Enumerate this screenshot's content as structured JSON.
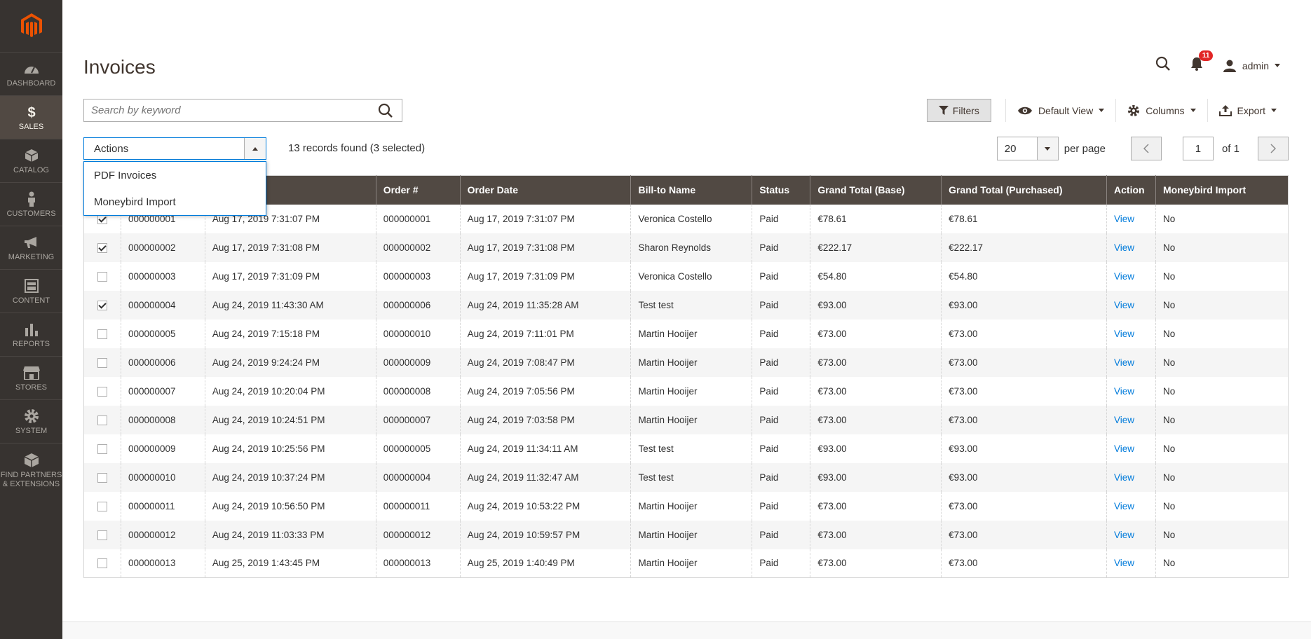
{
  "sidebar": {
    "items": [
      {
        "label": "DASHBOARD",
        "icon": "dashboard-icon"
      },
      {
        "label": "SALES",
        "icon": "dollar-icon",
        "active": true
      },
      {
        "label": "CATALOG",
        "icon": "cube-icon"
      },
      {
        "label": "CUSTOMERS",
        "icon": "person-icon"
      },
      {
        "label": "MARKETING",
        "icon": "megaphone-icon"
      },
      {
        "label": "CONTENT",
        "icon": "content-icon"
      },
      {
        "label": "REPORTS",
        "icon": "bar-chart-icon"
      },
      {
        "label": "STORES",
        "icon": "store-icon"
      },
      {
        "label": "SYSTEM",
        "icon": "gear-icon"
      }
    ],
    "partners": {
      "line1": "FIND PARTNERS",
      "line2": "& EXTENSIONS"
    }
  },
  "header": {
    "title": "Invoices",
    "notifications_count": "11",
    "user": "admin"
  },
  "search": {
    "placeholder": "Search by keyword"
  },
  "toolbar": {
    "filters": "Filters",
    "view": "Default View",
    "columns": "Columns",
    "export": "Export"
  },
  "actions": {
    "label": "Actions",
    "options": [
      "PDF Invoices",
      "Moneybird Import"
    ]
  },
  "records": "13 records found (3 selected)",
  "pager": {
    "per_page": "20",
    "per_page_label": "per page",
    "page": "1",
    "of": "of 1"
  },
  "grid": {
    "columns": [
      "",
      "",
      "",
      "Order #",
      "Order Date",
      "Bill-to Name",
      "Status",
      "Grand Total (Base)",
      "Grand Total (Purchased)",
      "Action",
      "Moneybird Import"
    ],
    "rows": [
      {
        "checked": true,
        "invoice": "000000001",
        "invoice_date": "Aug 17, 2019 7:31:07 PM",
        "order": "000000001",
        "order_date": "Aug 17, 2019 7:31:07 PM",
        "name": "Veronica Costello",
        "status": "Paid",
        "base": "€78.61",
        "purchased": "€78.61",
        "action": "View",
        "moneybird": "No"
      },
      {
        "checked": true,
        "invoice": "000000002",
        "invoice_date": "Aug 17, 2019 7:31:08 PM",
        "order": "000000002",
        "order_date": "Aug 17, 2019 7:31:08 PM",
        "name": "Sharon Reynolds",
        "status": "Paid",
        "base": "€222.17",
        "purchased": "€222.17",
        "action": "View",
        "moneybird": "No"
      },
      {
        "checked": false,
        "invoice": "000000003",
        "invoice_date": "Aug 17, 2019 7:31:09 PM",
        "order": "000000003",
        "order_date": "Aug 17, 2019 7:31:09 PM",
        "name": "Veronica Costello",
        "status": "Paid",
        "base": "€54.80",
        "purchased": "€54.80",
        "action": "View",
        "moneybird": "No"
      },
      {
        "checked": true,
        "invoice": "000000004",
        "invoice_date": "Aug 24, 2019 11:43:30 AM",
        "order": "000000006",
        "order_date": "Aug 24, 2019 11:35:28 AM",
        "name": "Test test",
        "status": "Paid",
        "base": "€93.00",
        "purchased": "€93.00",
        "action": "View",
        "moneybird": "No"
      },
      {
        "checked": false,
        "invoice": "000000005",
        "invoice_date": "Aug 24, 2019 7:15:18 PM",
        "order": "000000010",
        "order_date": "Aug 24, 2019 7:11:01 PM",
        "name": "Martin Hooijer",
        "status": "Paid",
        "base": "€73.00",
        "purchased": "€73.00",
        "action": "View",
        "moneybird": "No"
      },
      {
        "checked": false,
        "invoice": "000000006",
        "invoice_date": "Aug 24, 2019 9:24:24 PM",
        "order": "000000009",
        "order_date": "Aug 24, 2019 7:08:47 PM",
        "name": "Martin Hooijer",
        "status": "Paid",
        "base": "€73.00",
        "purchased": "€73.00",
        "action": "View",
        "moneybird": "No"
      },
      {
        "checked": false,
        "invoice": "000000007",
        "invoice_date": "Aug 24, 2019 10:20:04 PM",
        "order": "000000008",
        "order_date": "Aug 24, 2019 7:05:56 PM",
        "name": "Martin Hooijer",
        "status": "Paid",
        "base": "€73.00",
        "purchased": "€73.00",
        "action": "View",
        "moneybird": "No"
      },
      {
        "checked": false,
        "invoice": "000000008",
        "invoice_date": "Aug 24, 2019 10:24:51 PM",
        "order": "000000007",
        "order_date": "Aug 24, 2019 7:03:58 PM",
        "name": "Martin Hooijer",
        "status": "Paid",
        "base": "€73.00",
        "purchased": "€73.00",
        "action": "View",
        "moneybird": "No"
      },
      {
        "checked": false,
        "invoice": "000000009",
        "invoice_date": "Aug 24, 2019 10:25:56 PM",
        "order": "000000005",
        "order_date": "Aug 24, 2019 11:34:11 AM",
        "name": "Test test",
        "status": "Paid",
        "base": "€93.00",
        "purchased": "€93.00",
        "action": "View",
        "moneybird": "No"
      },
      {
        "checked": false,
        "invoice": "000000010",
        "invoice_date": "Aug 24, 2019 10:37:24 PM",
        "order": "000000004",
        "order_date": "Aug 24, 2019 11:32:47 AM",
        "name": "Test test",
        "status": "Paid",
        "base": "€93.00",
        "purchased": "€93.00",
        "action": "View",
        "moneybird": "No"
      },
      {
        "checked": false,
        "invoice": "000000011",
        "invoice_date": "Aug 24, 2019 10:56:50 PM",
        "order": "000000011",
        "order_date": "Aug 24, 2019 10:53:22 PM",
        "name": "Martin Hooijer",
        "status": "Paid",
        "base": "€73.00",
        "purchased": "€73.00",
        "action": "View",
        "moneybird": "No"
      },
      {
        "checked": false,
        "invoice": "000000012",
        "invoice_date": "Aug 24, 2019 11:03:33 PM",
        "order": "000000012",
        "order_date": "Aug 24, 2019 10:59:57 PM",
        "name": "Martin Hooijer",
        "status": "Paid",
        "base": "€73.00",
        "purchased": "€73.00",
        "action": "View",
        "moneybird": "No"
      },
      {
        "checked": false,
        "invoice": "000000013",
        "invoice_date": "Aug 25, 2019 1:43:45 PM",
        "order": "000000013",
        "order_date": "Aug 25, 2019 1:40:49 PM",
        "name": "Martin Hooijer",
        "status": "Paid",
        "base": "€73.00",
        "purchased": "€73.00",
        "action": "View",
        "moneybird": "No"
      }
    ]
  },
  "colors": {
    "sidebar": "#373330",
    "sidebar_active": "#514943",
    "header_row": "#514943",
    "link": "#007bdb",
    "brand": "#eb5202",
    "badge": "#e22626"
  }
}
